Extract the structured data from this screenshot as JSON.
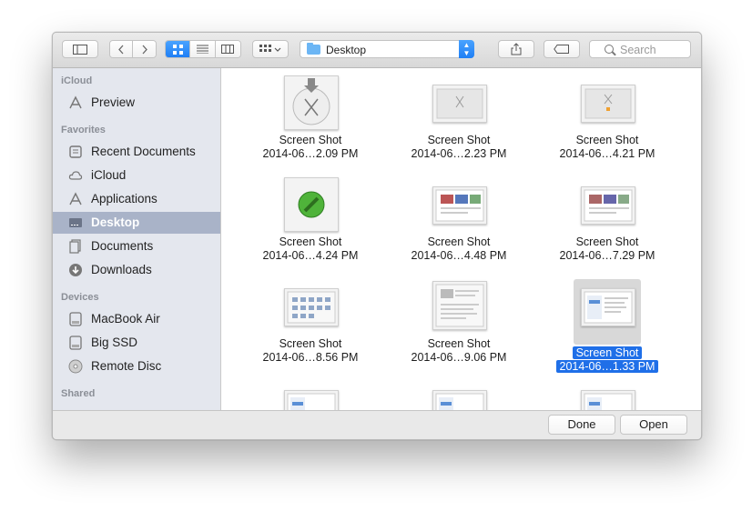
{
  "toolbar": {
    "path_folder": "Desktop",
    "search_placeholder": "Search"
  },
  "sidebar": {
    "sections": [
      {
        "title": "iCloud",
        "items": [
          {
            "label": "Preview",
            "icon": "apps-icon"
          }
        ]
      },
      {
        "title": "Favorites",
        "items": [
          {
            "label": "Recent Documents",
            "icon": "recent-documents-icon"
          },
          {
            "label": "iCloud",
            "icon": "cloud-icon"
          },
          {
            "label": "Applications",
            "icon": "applications-icon"
          },
          {
            "label": "Desktop",
            "icon": "desktop-icon",
            "selected": true
          },
          {
            "label": "Documents",
            "icon": "documents-icon"
          },
          {
            "label": "Downloads",
            "icon": "downloads-icon"
          }
        ]
      },
      {
        "title": "Devices",
        "items": [
          {
            "label": "MacBook Air",
            "icon": "disk-icon"
          },
          {
            "label": "Big SSD",
            "icon": "disk-icon"
          },
          {
            "label": "Remote Disc",
            "icon": "disc-icon"
          }
        ]
      },
      {
        "title": "Shared",
        "items": []
      }
    ]
  },
  "files": [
    {
      "line1": "Screen Shot",
      "line2": "2014-06…2.09 PM"
    },
    {
      "line1": "Screen Shot",
      "line2": "2014-06…2.23 PM"
    },
    {
      "line1": "Screen Shot",
      "line2": "2014-06…4.21 PM"
    },
    {
      "line1": "Screen Shot",
      "line2": "2014-06…4.24 PM"
    },
    {
      "line1": "Screen Shot",
      "line2": "2014-06…4.48 PM"
    },
    {
      "line1": "Screen Shot",
      "line2": "2014-06…7.29 PM"
    },
    {
      "line1": "Screen Shot",
      "line2": "2014-06…8.56 PM"
    },
    {
      "line1": "Screen Shot",
      "line2": "2014-06…9.06 PM"
    },
    {
      "line1": "Screen Shot",
      "line2": "2014-06…1.33 PM",
      "selected": true
    }
  ],
  "buttons": {
    "done": "Done",
    "open": "Open"
  },
  "colors": {
    "accent": "#1f7ff5",
    "selection": "#1f6fe8",
    "sidebar_selected": "#a9b3c8"
  }
}
